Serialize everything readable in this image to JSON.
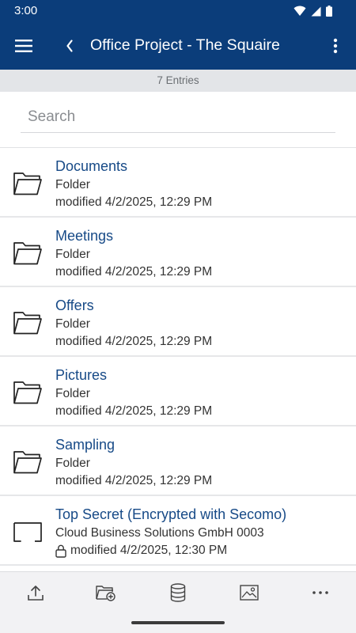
{
  "status_bar": {
    "time": "3:00"
  },
  "app_bar": {
    "title": "Office Project - The Squaire"
  },
  "entries_count": "7 Entries",
  "search": {
    "placeholder": "Search",
    "value": ""
  },
  "items": [
    {
      "name": "Documents",
      "type": "Folder",
      "modified": "modified 4/2/2025, 12:29 PM",
      "icon": "folder-icon"
    },
    {
      "name": "Meetings",
      "type": "Folder",
      "modified": "modified 4/2/2025, 12:29 PM",
      "icon": "folder-icon"
    },
    {
      "name": "Offers",
      "type": "Folder",
      "modified": "modified 4/2/2025, 12:29 PM",
      "icon": "folder-icon"
    },
    {
      "name": "Pictures",
      "type": "Folder",
      "modified": "modified 4/2/2025, 12:29 PM",
      "icon": "folder-icon"
    },
    {
      "name": "Sampling",
      "type": "Folder",
      "modified": "modified 4/2/2025, 12:29 PM",
      "icon": "folder-icon"
    },
    {
      "name": "Top Secret (Encrypted with Secomo)",
      "type": "Cloud Business Solutions GmbH 0003",
      "modified": "modified 4/2/2025, 12:30 PM",
      "icon": "encrypted-drive-icon",
      "locked": true
    }
  ],
  "toolbar": [
    {
      "icon": "upload-icon"
    },
    {
      "icon": "new-folder-icon"
    },
    {
      "icon": "database-icon"
    },
    {
      "icon": "image-icon"
    },
    {
      "icon": "more-horizontal-icon"
    }
  ],
  "colors": {
    "brand": "#0b3d7a",
    "link": "#174a87",
    "count_bar": "#e3e5e8"
  }
}
